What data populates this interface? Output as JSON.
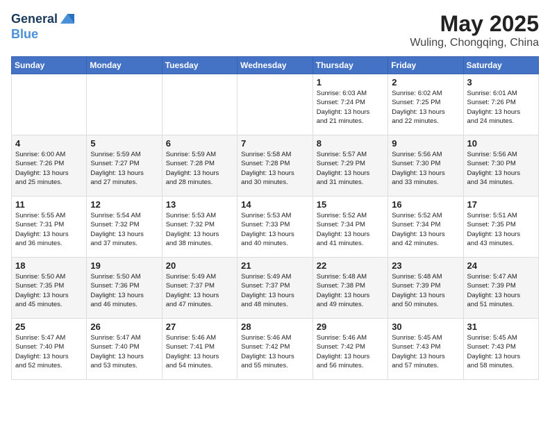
{
  "header": {
    "logo_line1": "General",
    "logo_line2": "Blue",
    "month_title": "May 2025",
    "location": "Wuling, Chongqing, China"
  },
  "days_of_week": [
    "Sunday",
    "Monday",
    "Tuesday",
    "Wednesday",
    "Thursday",
    "Friday",
    "Saturday"
  ],
  "weeks": [
    [
      {
        "day": "",
        "info": ""
      },
      {
        "day": "",
        "info": ""
      },
      {
        "day": "",
        "info": ""
      },
      {
        "day": "",
        "info": ""
      },
      {
        "day": "1",
        "info": "Sunrise: 6:03 AM\nSunset: 7:24 PM\nDaylight: 13 hours\nand 21 minutes."
      },
      {
        "day": "2",
        "info": "Sunrise: 6:02 AM\nSunset: 7:25 PM\nDaylight: 13 hours\nand 22 minutes."
      },
      {
        "day": "3",
        "info": "Sunrise: 6:01 AM\nSunset: 7:26 PM\nDaylight: 13 hours\nand 24 minutes."
      }
    ],
    [
      {
        "day": "4",
        "info": "Sunrise: 6:00 AM\nSunset: 7:26 PM\nDaylight: 13 hours\nand 25 minutes."
      },
      {
        "day": "5",
        "info": "Sunrise: 5:59 AM\nSunset: 7:27 PM\nDaylight: 13 hours\nand 27 minutes."
      },
      {
        "day": "6",
        "info": "Sunrise: 5:59 AM\nSunset: 7:28 PM\nDaylight: 13 hours\nand 28 minutes."
      },
      {
        "day": "7",
        "info": "Sunrise: 5:58 AM\nSunset: 7:28 PM\nDaylight: 13 hours\nand 30 minutes."
      },
      {
        "day": "8",
        "info": "Sunrise: 5:57 AM\nSunset: 7:29 PM\nDaylight: 13 hours\nand 31 minutes."
      },
      {
        "day": "9",
        "info": "Sunrise: 5:56 AM\nSunset: 7:30 PM\nDaylight: 13 hours\nand 33 minutes."
      },
      {
        "day": "10",
        "info": "Sunrise: 5:56 AM\nSunset: 7:30 PM\nDaylight: 13 hours\nand 34 minutes."
      }
    ],
    [
      {
        "day": "11",
        "info": "Sunrise: 5:55 AM\nSunset: 7:31 PM\nDaylight: 13 hours\nand 36 minutes."
      },
      {
        "day": "12",
        "info": "Sunrise: 5:54 AM\nSunset: 7:32 PM\nDaylight: 13 hours\nand 37 minutes."
      },
      {
        "day": "13",
        "info": "Sunrise: 5:53 AM\nSunset: 7:32 PM\nDaylight: 13 hours\nand 38 minutes."
      },
      {
        "day": "14",
        "info": "Sunrise: 5:53 AM\nSunset: 7:33 PM\nDaylight: 13 hours\nand 40 minutes."
      },
      {
        "day": "15",
        "info": "Sunrise: 5:52 AM\nSunset: 7:34 PM\nDaylight: 13 hours\nand 41 minutes."
      },
      {
        "day": "16",
        "info": "Sunrise: 5:52 AM\nSunset: 7:34 PM\nDaylight: 13 hours\nand 42 minutes."
      },
      {
        "day": "17",
        "info": "Sunrise: 5:51 AM\nSunset: 7:35 PM\nDaylight: 13 hours\nand 43 minutes."
      }
    ],
    [
      {
        "day": "18",
        "info": "Sunrise: 5:50 AM\nSunset: 7:35 PM\nDaylight: 13 hours\nand 45 minutes."
      },
      {
        "day": "19",
        "info": "Sunrise: 5:50 AM\nSunset: 7:36 PM\nDaylight: 13 hours\nand 46 minutes."
      },
      {
        "day": "20",
        "info": "Sunrise: 5:49 AM\nSunset: 7:37 PM\nDaylight: 13 hours\nand 47 minutes."
      },
      {
        "day": "21",
        "info": "Sunrise: 5:49 AM\nSunset: 7:37 PM\nDaylight: 13 hours\nand 48 minutes."
      },
      {
        "day": "22",
        "info": "Sunrise: 5:48 AM\nSunset: 7:38 PM\nDaylight: 13 hours\nand 49 minutes."
      },
      {
        "day": "23",
        "info": "Sunrise: 5:48 AM\nSunset: 7:39 PM\nDaylight: 13 hours\nand 50 minutes."
      },
      {
        "day": "24",
        "info": "Sunrise: 5:47 AM\nSunset: 7:39 PM\nDaylight: 13 hours\nand 51 minutes."
      }
    ],
    [
      {
        "day": "25",
        "info": "Sunrise: 5:47 AM\nSunset: 7:40 PM\nDaylight: 13 hours\nand 52 minutes."
      },
      {
        "day": "26",
        "info": "Sunrise: 5:47 AM\nSunset: 7:40 PM\nDaylight: 13 hours\nand 53 minutes."
      },
      {
        "day": "27",
        "info": "Sunrise: 5:46 AM\nSunset: 7:41 PM\nDaylight: 13 hours\nand 54 minutes."
      },
      {
        "day": "28",
        "info": "Sunrise: 5:46 AM\nSunset: 7:42 PM\nDaylight: 13 hours\nand 55 minutes."
      },
      {
        "day": "29",
        "info": "Sunrise: 5:46 AM\nSunset: 7:42 PM\nDaylight: 13 hours\nand 56 minutes."
      },
      {
        "day": "30",
        "info": "Sunrise: 5:45 AM\nSunset: 7:43 PM\nDaylight: 13 hours\nand 57 minutes."
      },
      {
        "day": "31",
        "info": "Sunrise: 5:45 AM\nSunset: 7:43 PM\nDaylight: 13 hours\nand 58 minutes."
      }
    ]
  ]
}
